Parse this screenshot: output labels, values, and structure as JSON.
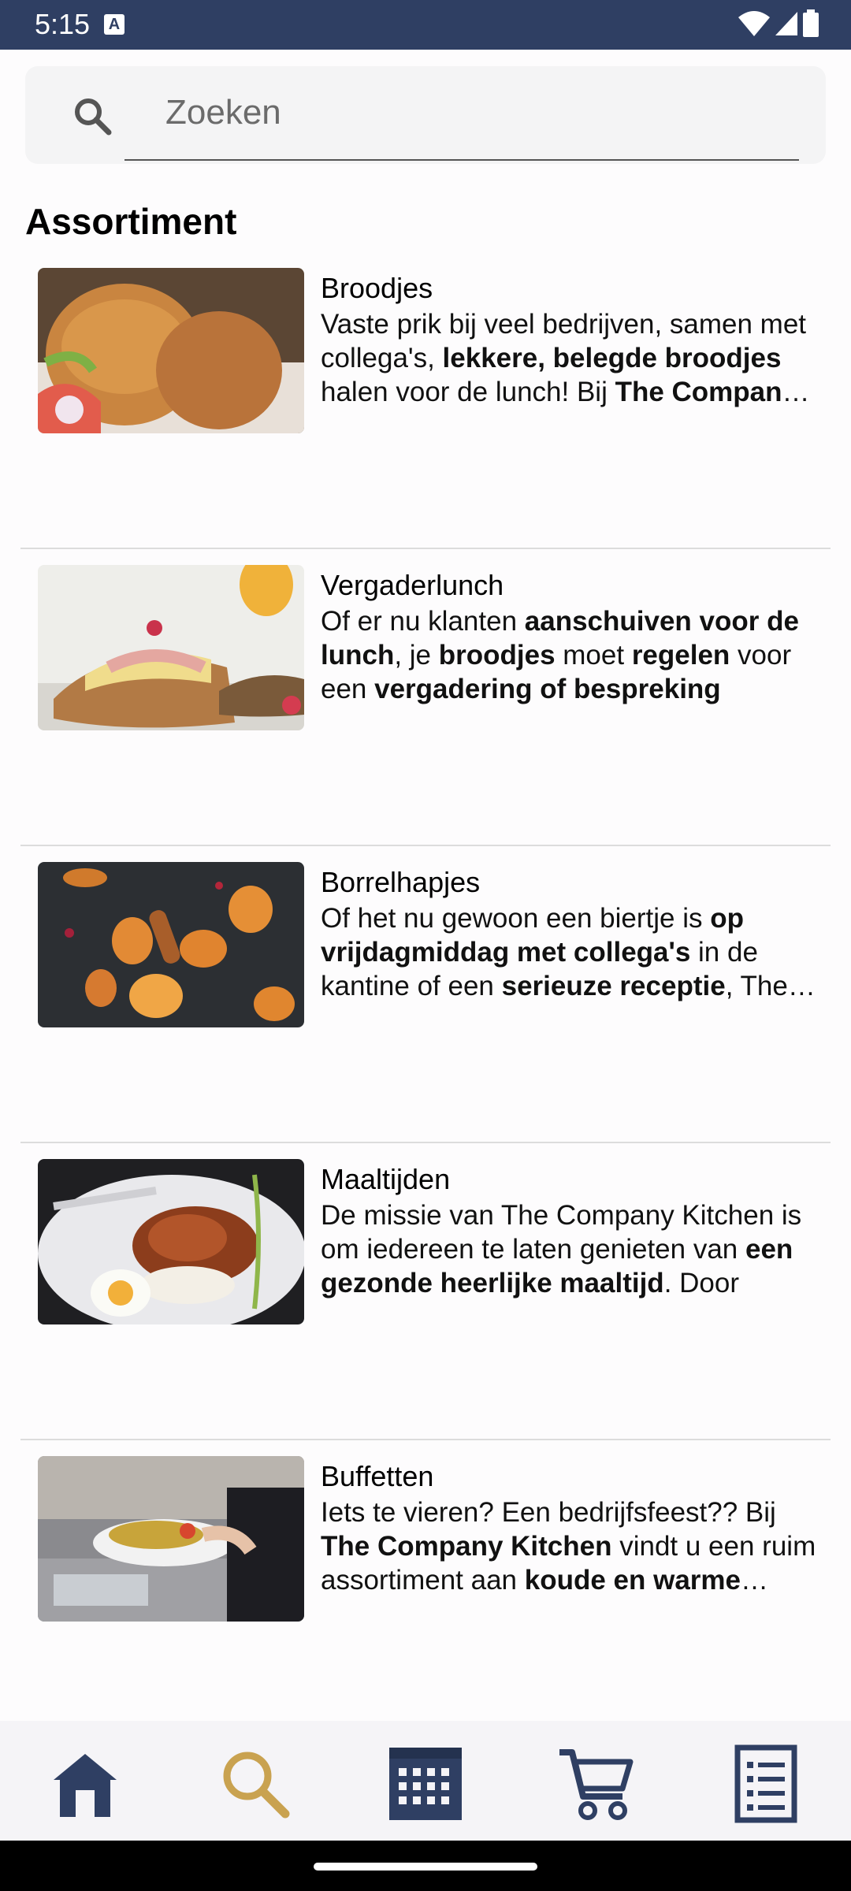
{
  "status_bar": {
    "time": "5:15",
    "notification_badge": "A"
  },
  "search": {
    "placeholder": "Zoeken",
    "value": ""
  },
  "section_title": "Assortiment",
  "items": [
    {
      "title": "Broodjes",
      "description": [
        "Vaste prik bij veel bedrijven, samen met collega's, ",
        {
          "b": "lekkere, belegde broodjes"
        },
        " halen voor de lunch! Bij ",
        {
          "b": "The Company Kitchen"
        }
      ]
    },
    {
      "title": "Vergaderlunch",
      "description": [
        "Of er nu klanten ",
        {
          "b": "aanschuiven voor de lunch"
        },
        ", je ",
        {
          "b": "broodjes"
        },
        " moet ",
        {
          "b": "regelen"
        },
        " voor een ",
        {
          "b": "vergadering of bespreking"
        }
      ]
    },
    {
      "title": "Borrelhapjes",
      "description": [
        "Of het nu gewoon een biertje is ",
        {
          "b": "op vrijdagmiddag met collega's"
        },
        " in de kantine of een ",
        {
          "b": "serieuze receptie"
        },
        ", The Company Kitchen"
      ]
    },
    {
      "title": "Maaltijden",
      "description": [
        "De missie van The Company Kitchen is om iedereen te laten genieten van ",
        {
          "b": "een gezonde heerlijke maaltijd"
        },
        ". Door"
      ]
    },
    {
      "title": "Buffetten",
      "description": [
        "Iets te vieren? Een bedrijfsfeest?? Bij ",
        {
          "b": "The Company Kitchen"
        },
        " vindt u een ruim assortiment aan ",
        {
          "b": "koude en warme buffetten"
        }
      ]
    }
  ],
  "nav": [
    {
      "icon": "home-icon",
      "active": false
    },
    {
      "icon": "search-icon",
      "active": true
    },
    {
      "icon": "calendar-icon",
      "active": false
    },
    {
      "icon": "cart-icon",
      "active": false
    },
    {
      "icon": "list-icon",
      "active": false
    }
  ],
  "colors": {
    "status_bar": "#2f3f63",
    "nav_icon": "#2f3f63",
    "nav_active": "#c9a250"
  }
}
